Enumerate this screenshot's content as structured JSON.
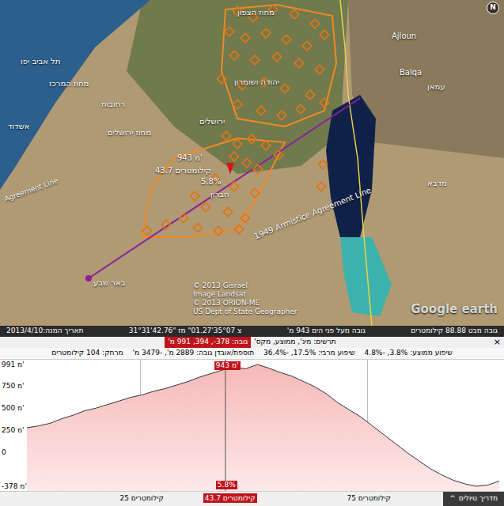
{
  "map": {
    "labels": [
      "מחוז הצפון",
      "Ajloun",
      "תל אביב יפו",
      "Balqa",
      "מחוז המרכז",
      "יהודה ושומרון",
      "עמאן",
      "רחובות",
      "אשדוד",
      "ירושלים",
      "מחוז ירושלים",
      "חברון",
      "מדבא",
      "באר שבע"
    ],
    "marker": {
      "elevation": "943 מ'",
      "distance": "43.7 קילומטרים",
      "slope": "5.8%"
    },
    "border_labels": [
      "1949 Armistice Agreement Line",
      "Agreement Line"
    ],
    "attribution": [
      "© 2013 Gisrael",
      "Image Landsat",
      "© 2013 ORION-ME",
      "US Dept of State Geographer"
    ],
    "logo": "Google earth",
    "compass": "N"
  },
  "status_bar": {
    "date": "תאריך המנה:2013/4/10",
    "coordinates": "31°31'42.76\" צ 35°07'01.27\" מז",
    "elevation": "גובה מעל פני הים 943 מ'",
    "eye_altitude": "גובה מבט 88.88 קילומטרים"
  },
  "profile": {
    "summary_label": "תרשים: מינ', ממוצע, מקס'",
    "summary_value": "גובה: 378-, 394, 991 מ'",
    "stats": [
      "שיפוע ממוצע: 3.8%, -4.8%",
      "שיפוע מרבי: 17.5%, -36.4%",
      "תוספת/אובדן גובה: 2889 מ', -3479 מ'",
      "מרחק: 104 קילומטרים"
    ],
    "close": "×",
    "y_ticks": [
      {
        "label": "991 מ'",
        "value": 991
      },
      {
        "label": "750 מ'",
        "value": 750
      },
      {
        "label": "500 מ'",
        "value": 500
      },
      {
        "label": "250 מ'",
        "value": 250
      },
      {
        "label": "0",
        "value": 0
      },
      {
        "label": "-378 מ'",
        "value": -378
      }
    ],
    "x_ticks": [
      {
        "label": "25 קילומטרים",
        "km": 25,
        "selected": false
      },
      {
        "label": "43.7 קילומטרים",
        "km": 43.7,
        "selected": true
      },
      {
        "label": "75 קילומטרים",
        "km": 75,
        "selected": false
      }
    ],
    "cursor": {
      "km": 43.7,
      "elevation": "943 מ'",
      "slope": "5.8%"
    },
    "series": {
      "distance_km": 104,
      "min": -378,
      "max": 991,
      "values": [
        280,
        300,
        330,
        380,
        420,
        470,
        500,
        540,
        580,
        620,
        650,
        690,
        720,
        760,
        800,
        850,
        890,
        930,
        960,
        943,
        991,
        950,
        900,
        860,
        800,
        740,
        660,
        560,
        480,
        400,
        300,
        200,
        100,
        0,
        -90,
        -180,
        -250,
        -310,
        -350,
        -378,
        -365,
        -320
      ]
    },
    "guide_button": {
      "label": "מדריך טיולים",
      "icon": "^"
    }
  }
}
